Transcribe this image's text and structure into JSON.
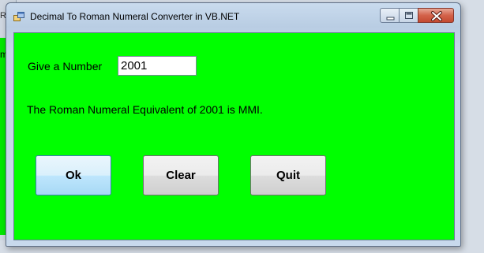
{
  "window": {
    "title": "Decimal To Roman Numeral Converter in VB.NET"
  },
  "background": {
    "partial_title": "Ro",
    "partial_text": "m"
  },
  "form": {
    "number_label": "Give a Number",
    "number_value": "2001",
    "result_text": "The Roman Numeral Equivalent of 2001 is MMI."
  },
  "buttons": {
    "ok": "Ok",
    "clear": "Clear",
    "quit": "Quit"
  },
  "icons": {
    "app": "app-window-icon",
    "minimize": "minimize-icon",
    "maximize": "maximize-icon",
    "close": "close-icon"
  },
  "colors": {
    "client_background": "#00ff00",
    "close_button": "#c44a31"
  }
}
